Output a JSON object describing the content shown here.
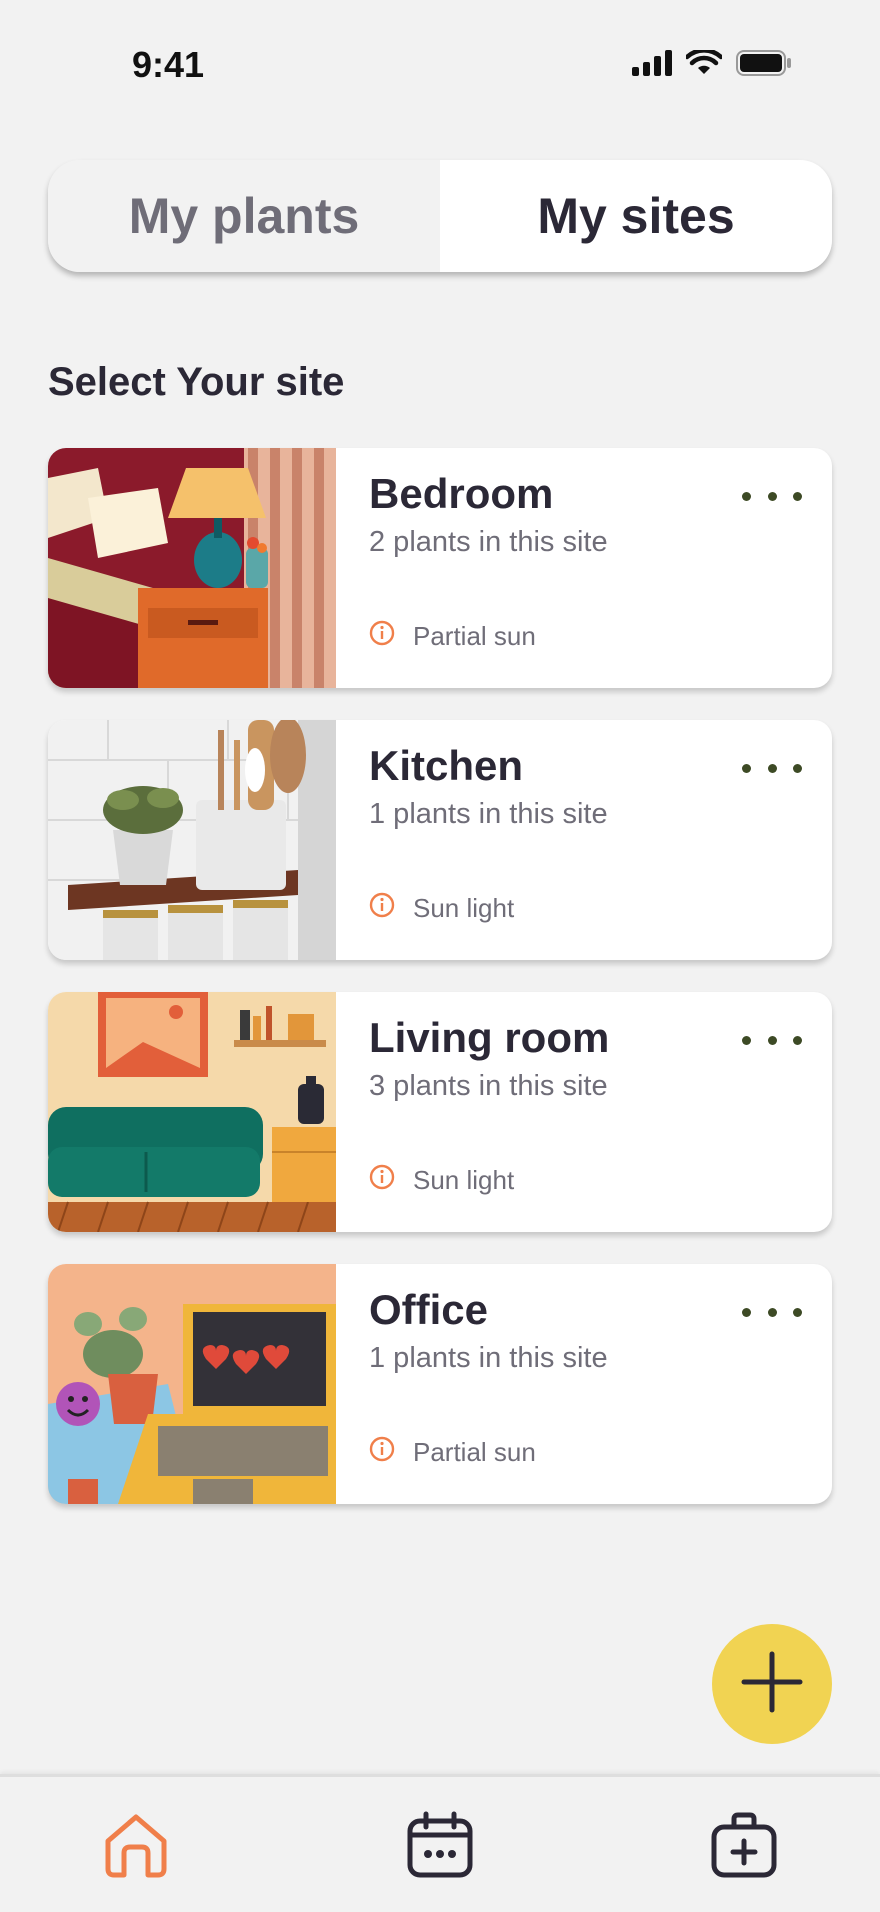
{
  "status_bar": {
    "time": "9:41",
    "icons": [
      "cellular-signal-icon",
      "wifi-icon",
      "battery-icon"
    ]
  },
  "segmented_control": {
    "tabs": [
      {
        "label": "My plants",
        "selected": false
      },
      {
        "label": "My sites",
        "selected": true
      }
    ]
  },
  "section_title": "Select Your site",
  "sites": [
    {
      "name": "Bedroom",
      "count_text": "2 plants in this site",
      "light": "Partial sun",
      "image": "bedroom-illustration"
    },
    {
      "name": "Kitchen",
      "count_text": "1 plants in this site",
      "light": "Sun light",
      "image": "kitchen-illustration"
    },
    {
      "name": "Living room",
      "count_text": "3 plants in this site",
      "light": "Sun light",
      "image": "living-room-illustration"
    },
    {
      "name": "Office",
      "count_text": "1 plants in this site",
      "light": "Partial sun",
      "image": "office-illustration"
    }
  ],
  "fab": {
    "icon": "plus-icon",
    "color": "#f1d352"
  },
  "bottom_nav": {
    "items": [
      {
        "icon": "home-icon",
        "active": true
      },
      {
        "icon": "calendar-icon",
        "active": false
      },
      {
        "icon": "first-aid-kit-icon",
        "active": false
      }
    ]
  },
  "colors": {
    "background": "#f2f2f2",
    "text_primary": "#2b2836",
    "text_secondary": "#6f6d78",
    "accent_orange": "#f07f4a",
    "more_dots": "#3d4a25"
  }
}
